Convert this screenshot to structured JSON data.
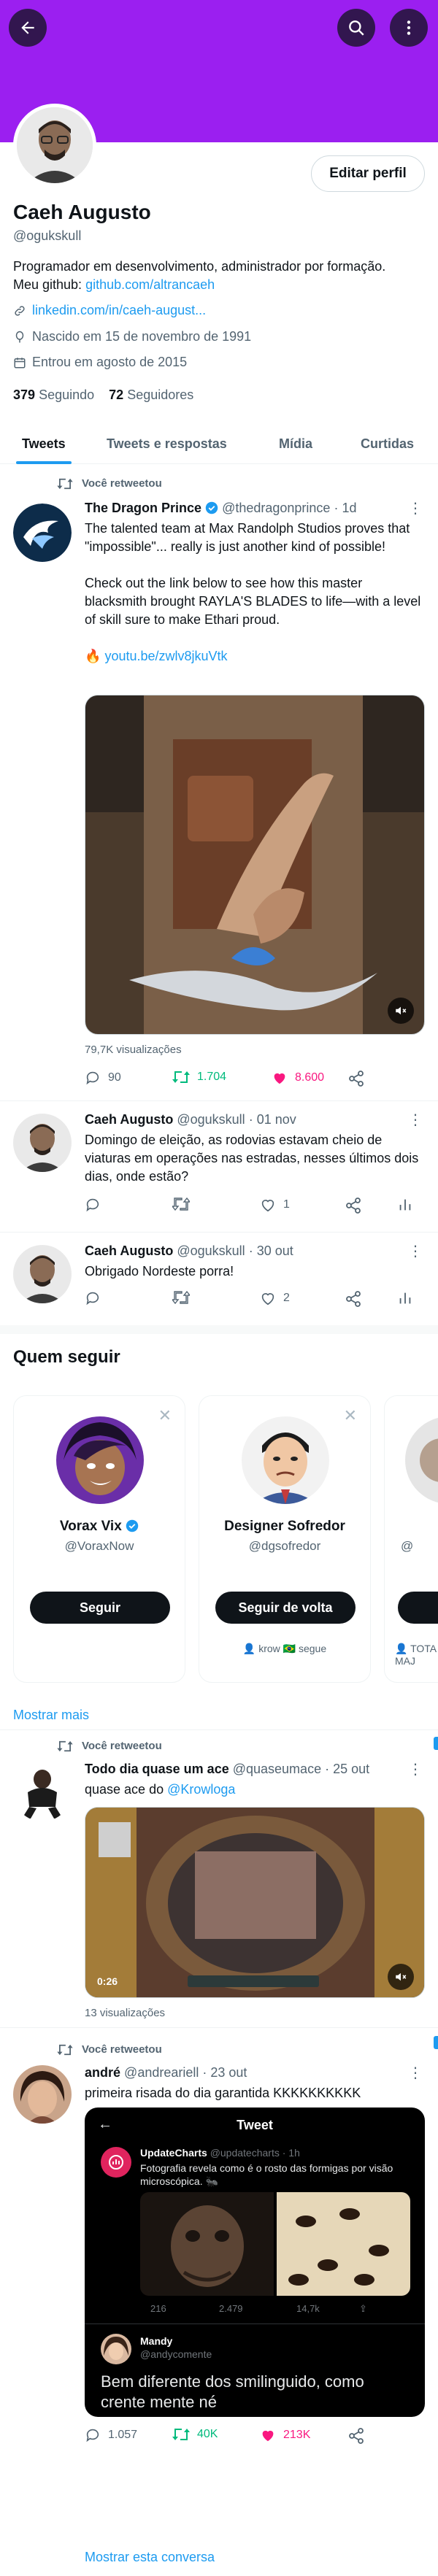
{
  "header": {
    "back_icon": "arrow-left-icon",
    "search_icon": "search-icon",
    "menu_icon": "more-vertical-icon",
    "banner_color": "#9b1ff0"
  },
  "profile": {
    "name": "Caeh Augusto",
    "handle": "@ogukskull",
    "edit_button": "Editar perfil",
    "bio_line1": "Programador em desenvolvimento, administrador por formação.",
    "bio_line2_prefix": "Meu github: ",
    "bio_link": "github.com/altrancaeh",
    "website": "linkedin.com/in/caeh-august...",
    "birthday": "Nascido em 15 de novembro de 1991",
    "joined": "Entrou em agosto de 2015",
    "following_count": "379",
    "following_label": "Seguindo",
    "followers_count": "72",
    "followers_label": "Seguidores"
  },
  "tabs": [
    "Tweets",
    "Tweets e respostas",
    "Mídia",
    "Curtidas"
  ],
  "tweets": [
    {
      "retweet_label": "Você retweetou",
      "name": "The Dragon Prince",
      "handle": "@thedragonprince",
      "time": "· 1d",
      "text1": "The talented team at Max Randolph Studios proves that \"impossible\"... really is just another kind of possible!",
      "text2": "Check out the link below to see how this master blacksmith brought RAYLA'S BLADES to life—with a level of skill sure to make Ethari proud.",
      "link": "youtu.be/zwlv8jkuVtk",
      "views": "79,7K visualizações",
      "replies": "90",
      "retweets": "1.704",
      "likes": "8.600"
    },
    {
      "name": "Caeh Augusto",
      "handle": "@ogukskull",
      "time": "· 01 nov",
      "text": "Domingo de eleição, as rodovias estavam cheio de viaturas em operações nas estradas, nesses últimos dois dias, onde estão?",
      "likes": "1"
    },
    {
      "name": "Caeh Augusto",
      "handle": "@ogukskull",
      "time": "· 30 out",
      "text": "Obrigado Nordeste porra!",
      "likes": "2"
    }
  ],
  "who_to_follow": {
    "title": "Quem seguir",
    "cards": [
      {
        "name": "Vorax Vix",
        "handle": "@VoraxNow",
        "button": "Seguir",
        "footer": ""
      },
      {
        "name": "Designer Sofredor",
        "handle": "@dgsofredor",
        "button": "Seguir de volta",
        "footer": "krow 🇧🇷 segue"
      },
      {
        "name": "",
        "handle": "@",
        "button": "Se",
        "footer": "TOTA MAJ"
      }
    ],
    "show_more": "Mostrar mais"
  },
  "tweet4": {
    "retweet_label": "Você retweetou",
    "name": "Todo dia quase um ace",
    "handle": "@quaseumace",
    "time": "· 25 out",
    "text_prefix": "quase ace do ",
    "mention": "@Krowloga",
    "video_time": "0:26",
    "views": "13 visualizações"
  },
  "tweet5": {
    "retweet_label": "Você retweetou",
    "name": "andré",
    "handle": "@andreariell",
    "time": "· 23 out",
    "text": "primeira risada do dia garantida KKKKKKKKKK",
    "embed": {
      "title": "Tweet",
      "inner_name": "UpdateCharts",
      "inner_handle": "@updatecharts · 1h",
      "inner_text": "Fotografia revela como é o rosto das formigas por visão microscópica. 🐜",
      "inner_replies": "216",
      "inner_retweets": "2.479",
      "inner_likes": "14,7k",
      "reply_name": "Mandy",
      "reply_handle": "@andycomente",
      "reply_text": "Bem diferente dos smilinguido, como crente mente né"
    },
    "replies": "1.057",
    "retweets": "40K",
    "likes": "213K",
    "show_thread": "Mostrar esta conversa"
  }
}
